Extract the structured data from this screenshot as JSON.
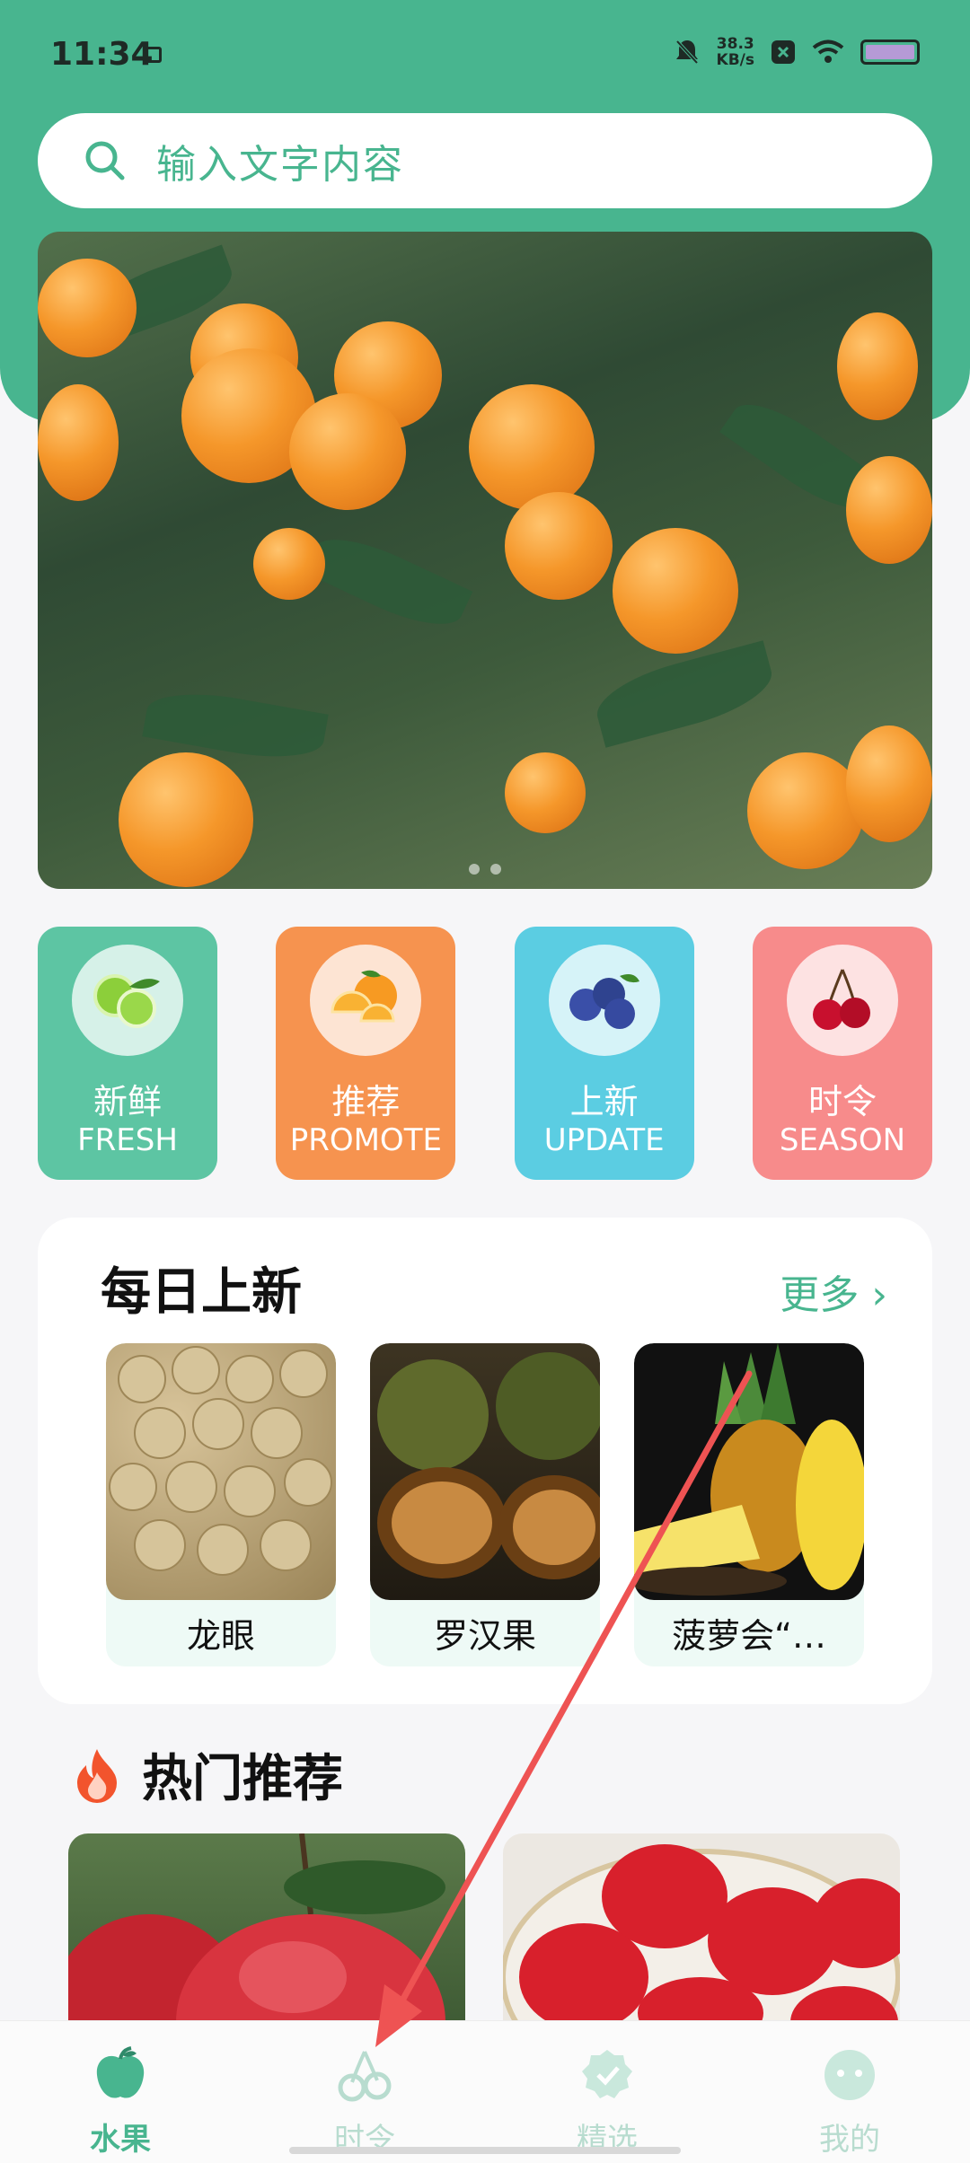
{
  "status_bar": {
    "time": "11:34",
    "speed_value": "38.3",
    "speed_unit": "KB/s"
  },
  "search": {
    "placeholder": "输入文字内容"
  },
  "banner": {
    "page_count": 2,
    "active_page": 1
  },
  "categories": [
    {
      "cn": "新鲜",
      "en": "FRESH",
      "color": "#5dc5a3",
      "icon": "lime-icon"
    },
    {
      "cn": "推荐",
      "en": "PROMOTE",
      "color": "#f6934f",
      "icon": "orange-icon"
    },
    {
      "cn": "上新",
      "en": "UPDATE",
      "color": "#5bcde2",
      "icon": "blueberry-icon"
    },
    {
      "cn": "时令",
      "en": "SEASON",
      "color": "#f78b8b",
      "icon": "cherry-icon"
    }
  ],
  "daily": {
    "title": "每日上新",
    "more": "更多",
    "items": [
      {
        "name": "龙眼"
      },
      {
        "name": "罗汉果"
      },
      {
        "name": "菠萝会“…"
      }
    ]
  },
  "hot": {
    "title": "热门推荐"
  },
  "tabbar": {
    "items": [
      {
        "label": "水果",
        "icon": "apple-icon"
      },
      {
        "label": "时令",
        "icon": "cherry-outline-icon"
      },
      {
        "label": "精选",
        "icon": "badge-check-icon"
      },
      {
        "label": "我的",
        "icon": "face-icon"
      }
    ],
    "active_index": 0
  },
  "colors": {
    "accent": "#48b58f",
    "annotation_arrow": "#ee5353"
  }
}
